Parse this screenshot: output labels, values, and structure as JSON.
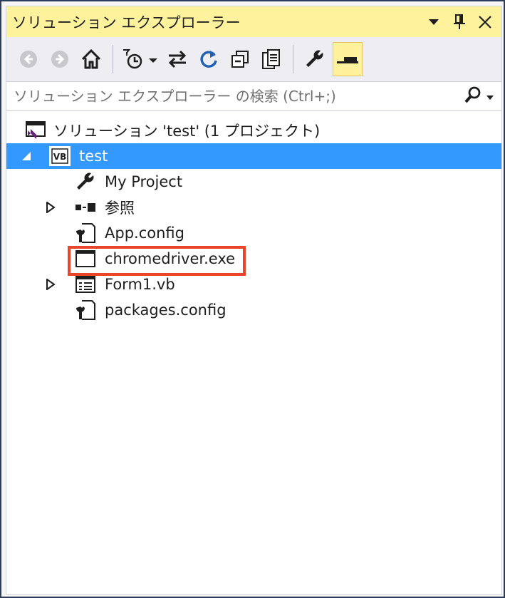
{
  "window": {
    "title": "ソリューション エクスプローラー"
  },
  "search": {
    "placeholder": "ソリューション エクスプローラー の検索 (Ctrl+;)"
  },
  "tree": {
    "solution": {
      "label": "ソリューション 'test' (1 プロジェクト)",
      "icon": "solution-icon"
    },
    "project": {
      "label": "test",
      "icon": "vb-project-icon",
      "selected": true
    },
    "items": [
      {
        "label": "My Project",
        "icon": "wrench-icon",
        "expandable": false
      },
      {
        "label": "参照",
        "icon": "references-icon",
        "expandable": true
      },
      {
        "label": "App.config",
        "icon": "config-file-icon",
        "expandable": false
      },
      {
        "label": "chromedriver.exe",
        "icon": "exe-file-icon",
        "expandable": false,
        "highlighted": true
      },
      {
        "label": "Form1.vb",
        "icon": "form-icon",
        "expandable": true
      },
      {
        "label": "packages.config",
        "icon": "config-file-icon",
        "expandable": false
      }
    ]
  },
  "colors": {
    "title_bar": "#fff29d",
    "selection": "#3399ff",
    "highlight_box": "#e8452c",
    "frame": "#2c3e5b"
  }
}
